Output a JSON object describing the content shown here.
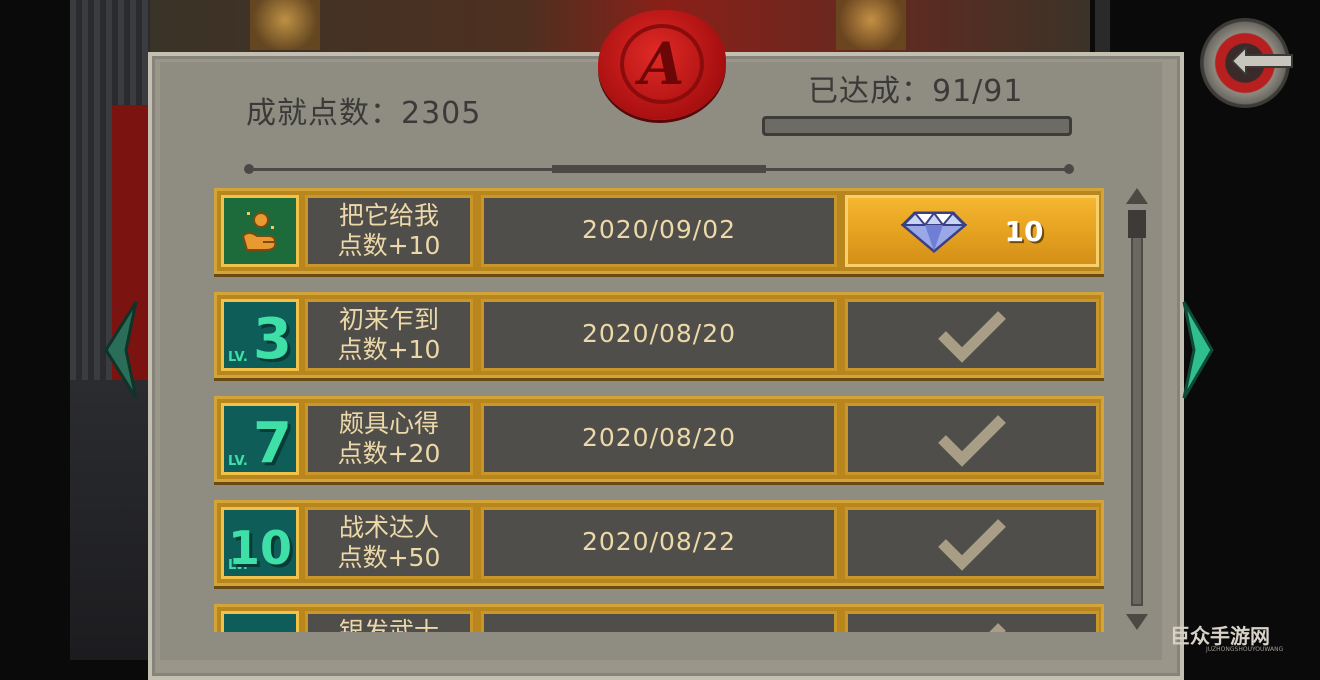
{
  "header": {
    "points_text": "成就点数：2305",
    "achieved_text": "已达成：91/91",
    "progress_fraction": 1.0,
    "seal_letter": "A"
  },
  "achievements": [
    {
      "badge": "hand-orb-icon",
      "name": "把它给我",
      "reward": "点数+10",
      "date": "2020/09/02",
      "status": "claimable",
      "claim_amount": "10"
    },
    {
      "badge_level": "3",
      "badge_prefix": "LV.",
      "name": "初来乍到",
      "reward": "点数+10",
      "date": "2020/08/20",
      "status": "claimed"
    },
    {
      "badge_level": "7",
      "badge_prefix": "LV.",
      "name": "颇具心得",
      "reward": "点数+20",
      "date": "2020/08/20",
      "status": "claimed"
    },
    {
      "badge_level": "10",
      "badge_prefix": "LV.",
      "name": "战术达人",
      "reward": "点数+50",
      "date": "2020/08/22",
      "status": "claimed"
    },
    {
      "badge_level": "",
      "badge_prefix": "",
      "name": "银发武士",
      "reward": "",
      "date": "",
      "status": "claimed"
    }
  ],
  "watermark": {
    "text": "巨众手游网",
    "sub": "JUZHONGSHOUYOUWANG"
  },
  "colors": {
    "panel": "#9a978a",
    "row_gold": "#b8861c",
    "cell_dark": "#4f4e4a",
    "text_cream": "#ecd8a8",
    "badge_teal": "#0e5d58",
    "badge_green": "#3fe0a8",
    "claim_orange": "#e6a320",
    "seal_red": "#c41818",
    "arrow_teal": "#2fbf8f"
  }
}
